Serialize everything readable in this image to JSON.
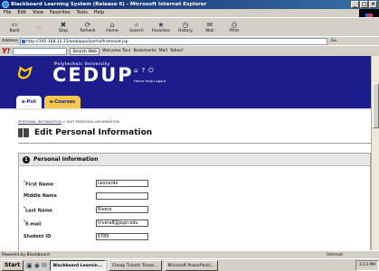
{
  "window": {
    "title": "Blackboard Learning System (Release 6) - Microsoft Internet Explorer"
  },
  "menu": [
    "File",
    "Edit",
    "View",
    "Favorites",
    "Tools",
    "Help"
  ],
  "toolbar": [
    {
      "label": "Back",
      "icon": "back-arrow-icon",
      "glyph": "⇦",
      "disabled": false
    },
    {
      "label": "",
      "icon": "forward-arrow-icon",
      "glyph": "⇨",
      "disabled": true
    },
    {
      "label": "Stop",
      "icon": "stop-icon",
      "glyph": "✖",
      "disabled": false
    },
    {
      "label": "Refresh",
      "icon": "refresh-icon",
      "glyph": "⟳",
      "disabled": false
    },
    {
      "label": "Home",
      "icon": "home-icon",
      "glyph": "⌂",
      "disabled": false
    },
    {
      "label": "Search",
      "icon": "search-icon",
      "glyph": "⌕",
      "disabled": false
    },
    {
      "label": "Favorites",
      "icon": "favorites-icon",
      "glyph": "★",
      "disabled": false
    },
    {
      "label": "History",
      "icon": "history-icon",
      "glyph": "◷",
      "disabled": false
    },
    {
      "label": "Mail",
      "icon": "mail-icon",
      "glyph": "✉",
      "disabled": false
    },
    {
      "label": "Print",
      "icon": "print-icon",
      "glyph": "⎙",
      "disabled": false
    }
  ],
  "address": {
    "label": "Address",
    "url": "http://192.168.12.15/webapps/portal/frameset.jsp",
    "go": "Go"
  },
  "yahoo": {
    "search_label": "Search Web",
    "welcome": "Welcome Tour",
    "bookmarks": "Bookmarks",
    "mail": "Mail",
    "yahoo": "Yahoo!"
  },
  "banner": {
    "university": "Polytechnic University",
    "brand": "CEDUP",
    "links": "Home  Help  Logout"
  },
  "tabs": [
    {
      "label": "e-Poli",
      "active": true
    },
    {
      "label": "e-Courses",
      "active": false
    }
  ],
  "breadcrumb": {
    "link": "PERSONAL INFORMATION",
    "current": "> EDIT PERSONAL INFORMATION"
  },
  "page": {
    "title": "Edit Personal Information"
  },
  "section": {
    "number": "1",
    "title": "Personal Information"
  },
  "form": [
    {
      "label": "First Name",
      "required": true,
      "value": "Leonardo"
    },
    {
      "label": "Middle Name",
      "required": false,
      "value": ""
    },
    {
      "label": "Last Name",
      "required": true,
      "value": "Rivera"
    },
    {
      "label": "E-mail",
      "required": true,
      "value": "lrivera8@pupr.edu"
    },
    {
      "label": "Student ID",
      "required": false,
      "value": "6789"
    }
  ],
  "status": {
    "left": "Powered by Blackboard",
    "right": "Internet"
  },
  "taskbar": {
    "start": "Start",
    "tasks": [
      {
        "label": "Blackboard Learnin...",
        "active": true
      },
      {
        "label": "Cheap Tickets Travel...",
        "active": false
      },
      {
        "label": "Microsoft PowerPoint...",
        "active": false
      }
    ],
    "clock": "3:13 PM"
  }
}
